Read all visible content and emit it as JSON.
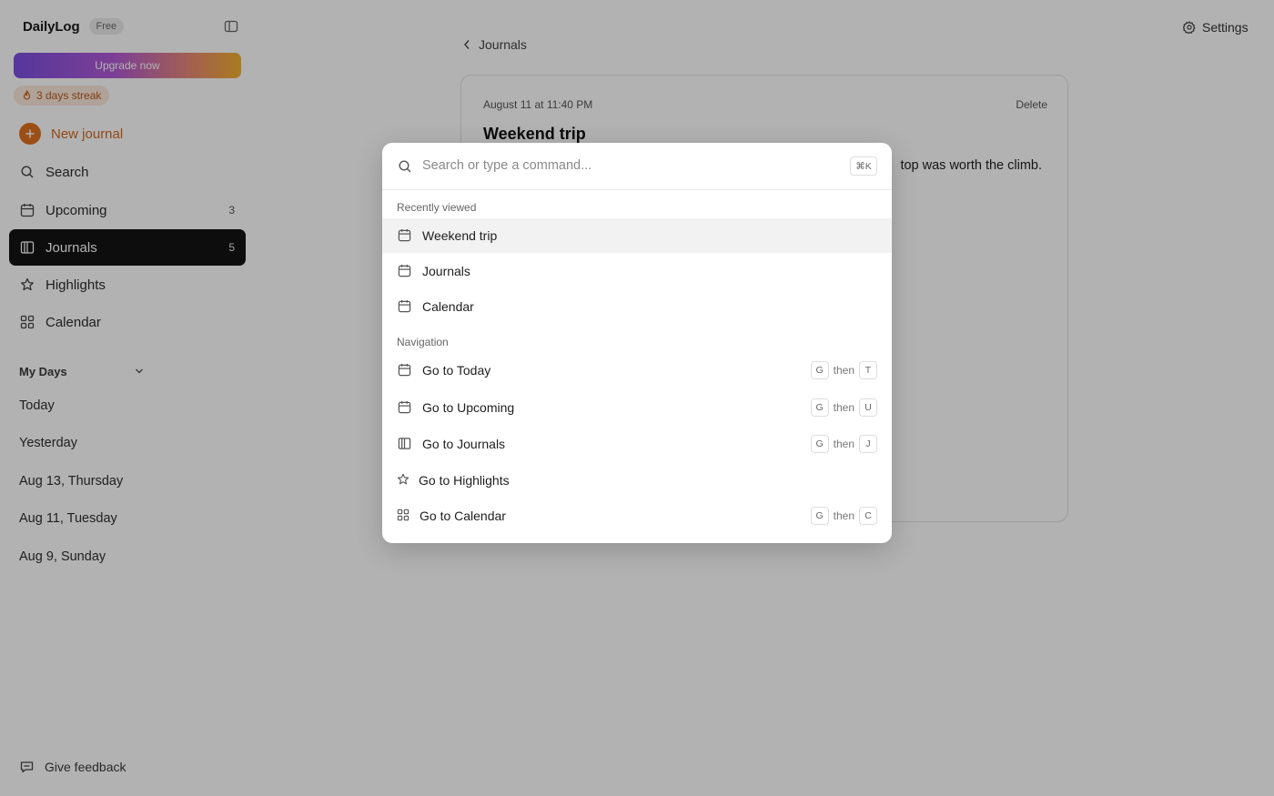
{
  "sidebar": {
    "brand": "DailyLog",
    "plan_badge": "Free",
    "upgrade_label": "Upgrade now",
    "streak_label": "3 days streak",
    "new_journal_label": "New journal",
    "nav": [
      {
        "label": "Search",
        "icon": "search-icon"
      },
      {
        "label": "Upcoming",
        "icon": "calendar-icon",
        "count": "3"
      },
      {
        "label": "Journals",
        "icon": "book-icon",
        "count": "5",
        "active": true
      },
      {
        "label": "Highlights",
        "icon": "star-icon"
      },
      {
        "label": "Calendar",
        "icon": "grid-icon"
      }
    ],
    "section_title": "My Days",
    "days": [
      "Today",
      "Yesterday",
      "Aug 13, Thursday",
      "Aug 11, Tuesday",
      "Aug 9, Sunday"
    ],
    "feedback_label": "Give feedback"
  },
  "main": {
    "back_label": "Journals",
    "settings_label": "Settings",
    "entry": {
      "date": "August 11 at 11:40 PM",
      "delete_label": "Delete",
      "title": "Weekend trip",
      "body_visible": "top was worth the climb."
    }
  },
  "palette": {
    "placeholder": "Search or type a command...",
    "shortcut": "⌘K",
    "groups": [
      {
        "label": "Recently viewed",
        "items": [
          {
            "label": "Weekend trip",
            "icon": "calendar-icon",
            "selected": true
          },
          {
            "label": "Journals",
            "icon": "calendar-icon"
          },
          {
            "label": "Calendar",
            "icon": "calendar-icon"
          }
        ]
      },
      {
        "label": "Navigation",
        "then_label": "then",
        "items": [
          {
            "label": "Go to Today",
            "icon": "calendar-icon",
            "keys": [
              "G",
              "T"
            ]
          },
          {
            "label": "Go to Upcoming",
            "icon": "calendar-icon",
            "keys": [
              "G",
              "U"
            ]
          },
          {
            "label": "Go to Journals",
            "icon": "book-icon",
            "keys": [
              "G",
              "J"
            ]
          },
          {
            "label": "Go to Highlights",
            "icon": "star-icon"
          },
          {
            "label": "Go to Calendar",
            "icon": "grid-icon",
            "keys": [
              "G",
              "C"
            ]
          }
        ]
      }
    ]
  },
  "colors": {
    "accent_orange": "#e0711f",
    "active_nav_bg": "#141414",
    "streak_bg": "#fbe9dc",
    "streak_text": "#b75a18"
  }
}
